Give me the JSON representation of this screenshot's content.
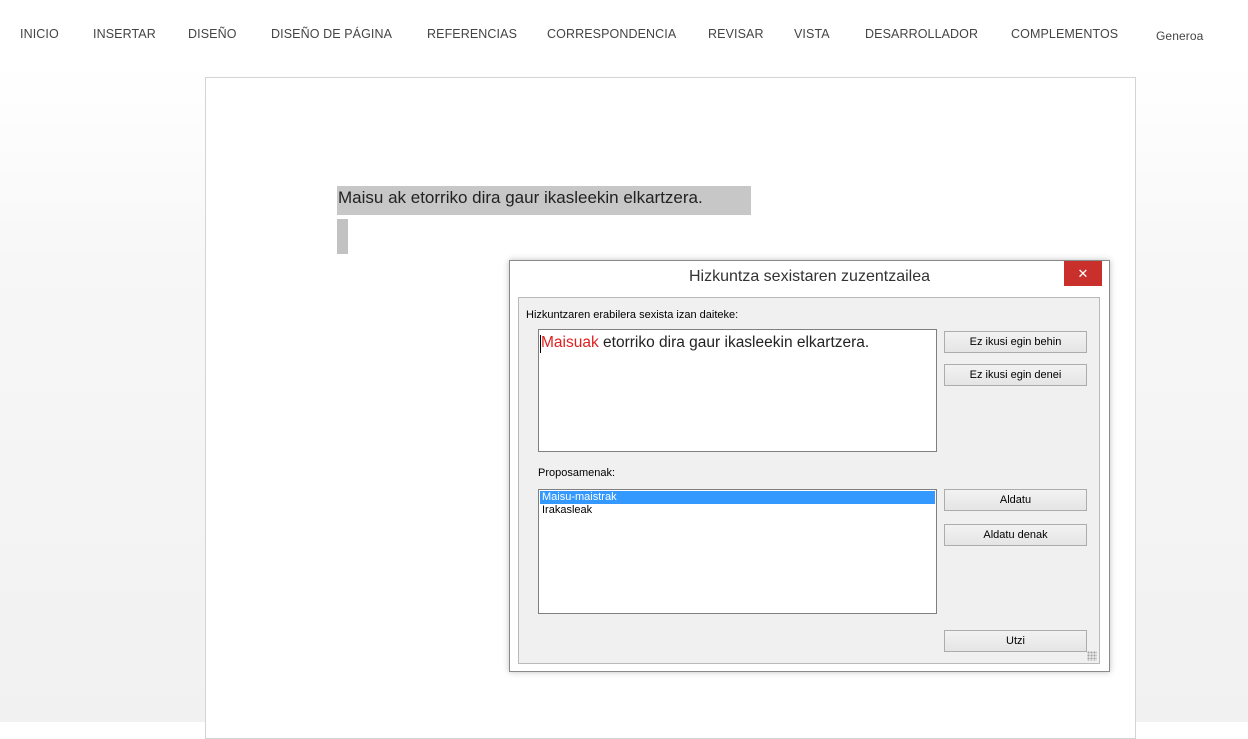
{
  "ribbon": {
    "tabs": [
      "INICIO",
      "INSERTAR",
      "DISEÑO",
      "DISEÑO DE PÁGINA",
      "REFERENCIAS",
      "CORRESPONDENCIA",
      "REVISAR",
      "VISTA",
      "DESARROLLADOR",
      "COMPLEMENTOS"
    ],
    "custom_tab": "Generoa"
  },
  "document": {
    "line1": "Maisu ak etorriko dira gaur ikasleekin  elkartzera."
  },
  "dialog": {
    "title": "Hizkuntza sexistaren zuzentzailea",
    "close_glyph": "✕",
    "usage_label": "Hizkuntzaren erabilera sexista izan daiteke:",
    "flagged_word": "Maisuak",
    "sentence_rest": " etorriko dira gaur ikasleekin elkartzera.",
    "ignore_once": "Ez ikusi egin behin",
    "ignore_all": "Ez ikusi egin denei",
    "proposals_label": "Proposamenak:",
    "proposals": [
      "Maisu-maistrak",
      "Irakasleak"
    ],
    "selected_index": 0,
    "change": "Aldatu",
    "change_all": "Aldatu denak",
    "cancel": "Utzi"
  },
  "colors": {
    "selection_blue": "#3399ff",
    "error_red": "#e02020",
    "close_red": "#c9302c"
  }
}
